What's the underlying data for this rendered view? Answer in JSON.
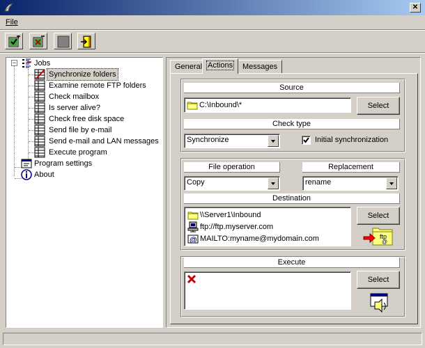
{
  "menu": {
    "file": "File"
  },
  "tree": {
    "root": "Jobs",
    "jobs": [
      "Synchronize folders",
      "Examine remote FTP folders",
      "Check mailbox",
      "Is server alive?",
      "Check free disk space",
      "Send file by e-mail",
      "Send e-mail and LAN messages",
      "Execute program"
    ],
    "program_settings": "Program settings",
    "about": "About",
    "selected": "Synchronize folders"
  },
  "tabs": [
    "General",
    "Actions",
    "Messages"
  ],
  "active_tab": "Actions",
  "source": {
    "header": "Source",
    "value": "C:\\Inbound\\*",
    "select_label": "Select"
  },
  "check_type": {
    "header": "Check type",
    "value": "Synchronize",
    "initial_sync_label": "Initial synchronization",
    "initial_sync_checked": true
  },
  "file_operation": {
    "header": "File operation",
    "value": "Copy"
  },
  "replacement": {
    "header": "Replacement",
    "value": "rename"
  },
  "destination": {
    "header": "Destination",
    "items": [
      {
        "icon": "folder-icon",
        "text": "\\\\Server1\\Inbound"
      },
      {
        "icon": "network-computer-icon",
        "text": "ftp://ftp.myserver.com"
      },
      {
        "icon": "email-icon",
        "text": "MAILTO:myname@mydomain.com"
      }
    ],
    "select_label": "Select"
  },
  "execute": {
    "header": "Execute",
    "select_label": "Select"
  },
  "colors": {
    "title_start": "#0a246a",
    "title_end": "#a6caf0",
    "face": "#d4d0c8"
  }
}
